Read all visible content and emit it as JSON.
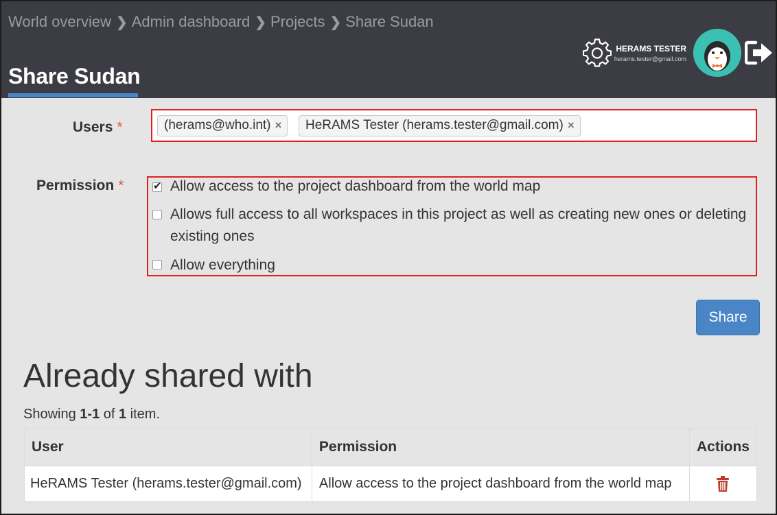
{
  "breadcrumb": [
    "World overview",
    "Admin dashboard",
    "Projects",
    "Share Sudan"
  ],
  "page_title": "Share Sudan",
  "user": {
    "name": "HERAMS TESTER",
    "email": "herams.tester@gmail.com"
  },
  "form": {
    "users_label": "Users",
    "required_mark": "*",
    "selected_users": [
      "(herams@who.int)",
      "HeRAMS Tester (herams.tester@gmail.com)"
    ],
    "permission_label": "Permission",
    "permissions": [
      {
        "line1": "Allow access to the project dashboard from the world map",
        "line2": "",
        "checked": true
      },
      {
        "line1": "Allows full access to all workspaces in this project as well as creating new ones or deleting",
        "line2": "existing ones",
        "checked": false
      },
      {
        "line1": "Allow everything",
        "line2": "",
        "checked": false
      }
    ],
    "share_button": "Share"
  },
  "shared": {
    "title": "Already shared with",
    "summary_prefix": "Showing ",
    "summary_range": "1-1",
    "summary_of": " of ",
    "summary_total": "1",
    "summary_suffix": " item.",
    "columns": [
      "User",
      "Permission",
      "Actions"
    ],
    "rows": [
      {
        "user": "HeRAMS Tester (herams.tester@gmail.com)",
        "permission": "Allow access to the project dashboard from the world map"
      }
    ]
  },
  "colors": {
    "header_bg": "#3c3d44",
    "accent": "#4a86c7",
    "highlight_border": "#e02020",
    "delete": "#c0392b",
    "avatar_bg": "#3bc0b1"
  },
  "icons": [
    "chevron-right-icon",
    "gear-icon",
    "avatar-icon",
    "logout-icon",
    "close-icon",
    "trash-icon"
  ]
}
